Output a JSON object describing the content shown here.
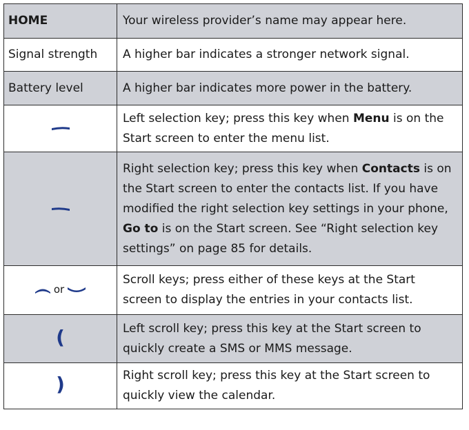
{
  "rows": [
    {
      "key": "HOME",
      "text": "Your wireless provider’s name may appear here."
    },
    {
      "key": "Signal strength",
      "text": "A higher bar indicates a stronger network signal."
    },
    {
      "key": "Battery level",
      "text": "A higher bar indicates more power in the battery."
    },
    {
      "key_icon": "left-selection-key-icon",
      "text_1": "Left selection key; press this key when ",
      "bold_1": "Menu",
      "text_2": " is on the Start screen to enter the menu list."
    },
    {
      "key_icon": "right-selection-key-icon",
      "text_1": "Right selection key; press this key when ",
      "bold_1": "Contacts",
      "text_2": " is on the Start screen to enter the contacts list. If you have modified the right selection key settings in your phone, ",
      "bold_2": "Go to",
      "text_3": " is on the Start screen. See “Right selection key settings” on page 85 for details."
    },
    {
      "key_icon": "scroll-keys-icon",
      "key_or": "or",
      "text": " Scroll keys; press either of these keys at the Start screen to display the entries in your contacts list."
    },
    {
      "key_glyph": "(",
      "text": "Left scroll key; press this key at the Start screen to quickly create a SMS or MMS message."
    },
    {
      "key_glyph": ")",
      "text": "Right scroll key; press this key at the Start screen to quickly view the calendar."
    }
  ],
  "colors": {
    "shaded_row": "#cfd1d7",
    "key_icon": "#1f3a8a",
    "border": "#2c2c2c"
  }
}
